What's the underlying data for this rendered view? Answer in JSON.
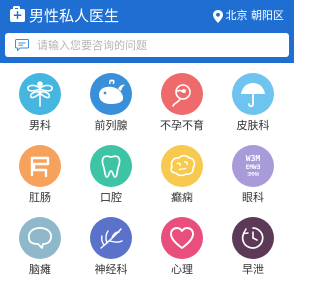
{
  "header": {
    "title": "男性私人医生",
    "location": "北京 朝阳区",
    "background": "#1f6fd3"
  },
  "search": {
    "placeholder": "请输入您要咨询的问题"
  },
  "categories": [
    {
      "label": "男科",
      "icon": "dragonfly-icon",
      "color": "#45b6e0"
    },
    {
      "label": "前列腺",
      "icon": "whale-icon",
      "color": "#3a8fd9"
    },
    {
      "label": "不孕不育",
      "icon": "sperm-icon",
      "color": "#ef6b6b"
    },
    {
      "label": "皮肤科",
      "icon": "umbrella-icon",
      "color": "#6fc3ef"
    },
    {
      "label": "肛肠",
      "icon": "intestine-icon",
      "color": "#f7a25c"
    },
    {
      "label": "口腔",
      "icon": "tooth-icon",
      "color": "#3cc4a5"
    },
    {
      "label": "癫痫",
      "icon": "brain-icon",
      "color": "#f7c94f"
    },
    {
      "label": "眼科",
      "icon": "eye-chart-icon",
      "color": "#a99ad9",
      "icon_text": [
        "W3M",
        "EMWƎ",
        "ƎMMW"
      ]
    },
    {
      "label": "脑瘫",
      "icon": "brain-outline-icon",
      "color": "#8fb9cb"
    },
    {
      "label": "神经科",
      "icon": "nerve-icon",
      "color": "#5a72c9"
    },
    {
      "label": "心理",
      "icon": "heart-icon",
      "color": "#e84f7c"
    },
    {
      "label": "早泄",
      "icon": "timer-icon",
      "color": "#5c3a57"
    }
  ]
}
